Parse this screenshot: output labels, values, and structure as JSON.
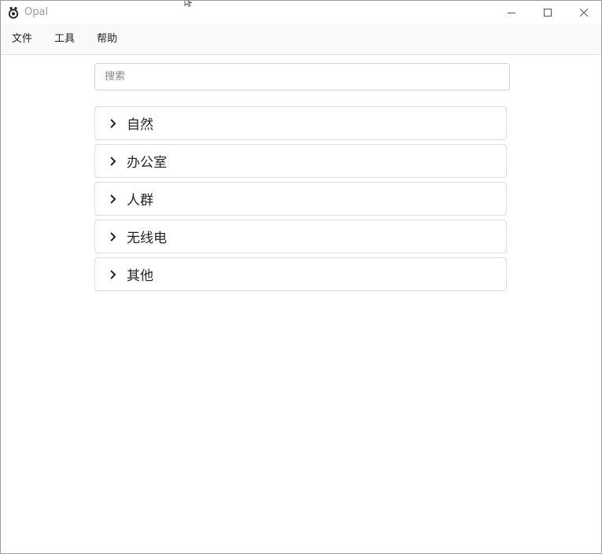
{
  "window": {
    "title": "Opal",
    "icon": "opal-app-icon",
    "controls": [
      "minimize-icon",
      "maximize-icon",
      "close-icon"
    ]
  },
  "menu": [
    {
      "label": "文件"
    },
    {
      "label": "工具"
    },
    {
      "label": "帮助"
    }
  ],
  "search": {
    "placeholder": "搜索",
    "value": ""
  },
  "categories": [
    {
      "label": "自然",
      "icon": "chevron-right-icon",
      "expanded": false
    },
    {
      "label": "办公室",
      "icon": "chevron-right-icon",
      "expanded": false
    },
    {
      "label": "人群",
      "icon": "chevron-right-icon",
      "expanded": false
    },
    {
      "label": "无线电",
      "icon": "chevron-right-icon",
      "expanded": false
    },
    {
      "label": "其他",
      "icon": "chevron-right-icon",
      "expanded": false
    }
  ],
  "colors": {
    "menubar_bg": "#f8f9fa",
    "border": "#dcdcdc",
    "text": "#212529",
    "title_text": "#9b9b9b"
  }
}
